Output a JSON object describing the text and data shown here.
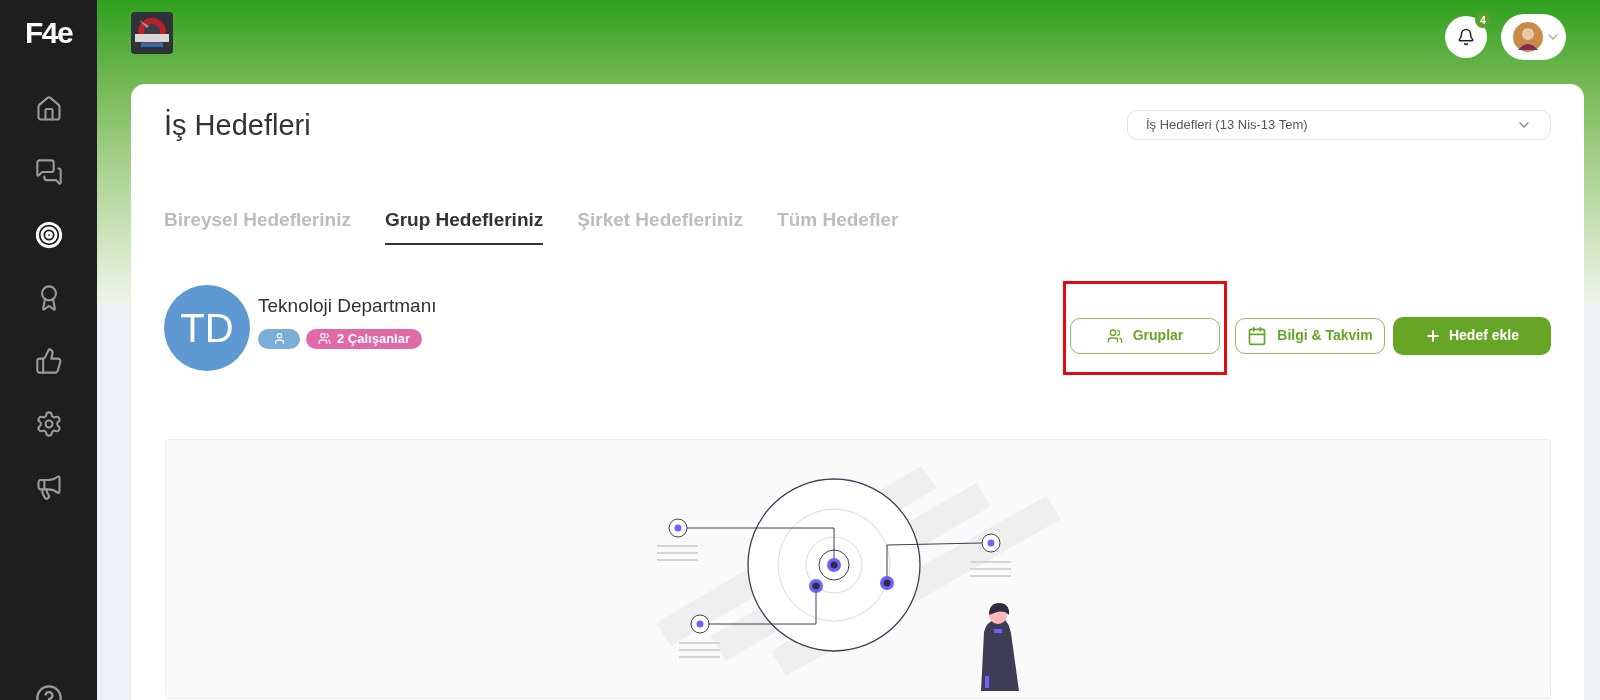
{
  "sidebar": {
    "logo": "F4e",
    "items": [
      {
        "selected": false
      },
      {
        "selected": false
      },
      {
        "selected": true
      },
      {
        "selected": false
      },
      {
        "selected": false
      },
      {
        "selected": false
      },
      {
        "selected": false
      }
    ]
  },
  "header": {
    "notifications": {
      "count": "4"
    }
  },
  "page": {
    "title": "İş Hedefleri",
    "period": {
      "value": "İş Hedefleri (13 Nis-13 Tem)"
    }
  },
  "tabs": [
    {
      "label": "Bireysel Hedefleriniz",
      "selected": false
    },
    {
      "label": "Grup Hedefleriniz",
      "selected": true
    },
    {
      "label": "Şirket Hedefleriniz",
      "selected": false
    },
    {
      "label": "Tüm Hedefler",
      "selected": false
    }
  ],
  "group": {
    "initials": "TD",
    "name": "Teknoloji Departmanı",
    "badges": [
      {
        "kind": "icon",
        "color": "#7aaed6"
      },
      {
        "kind": "count",
        "label": "2 Çalışanlar",
        "color": "#e06aa8"
      }
    ]
  },
  "actions": [
    {
      "label": "Gruplar",
      "kind": "outline",
      "highlighted": true
    },
    {
      "label": "Bilgi & Takvim",
      "kind": "outline",
      "highlighted": false
    },
    {
      "label": "Hedef ekle",
      "kind": "primary",
      "highlighted": false
    }
  ]
}
